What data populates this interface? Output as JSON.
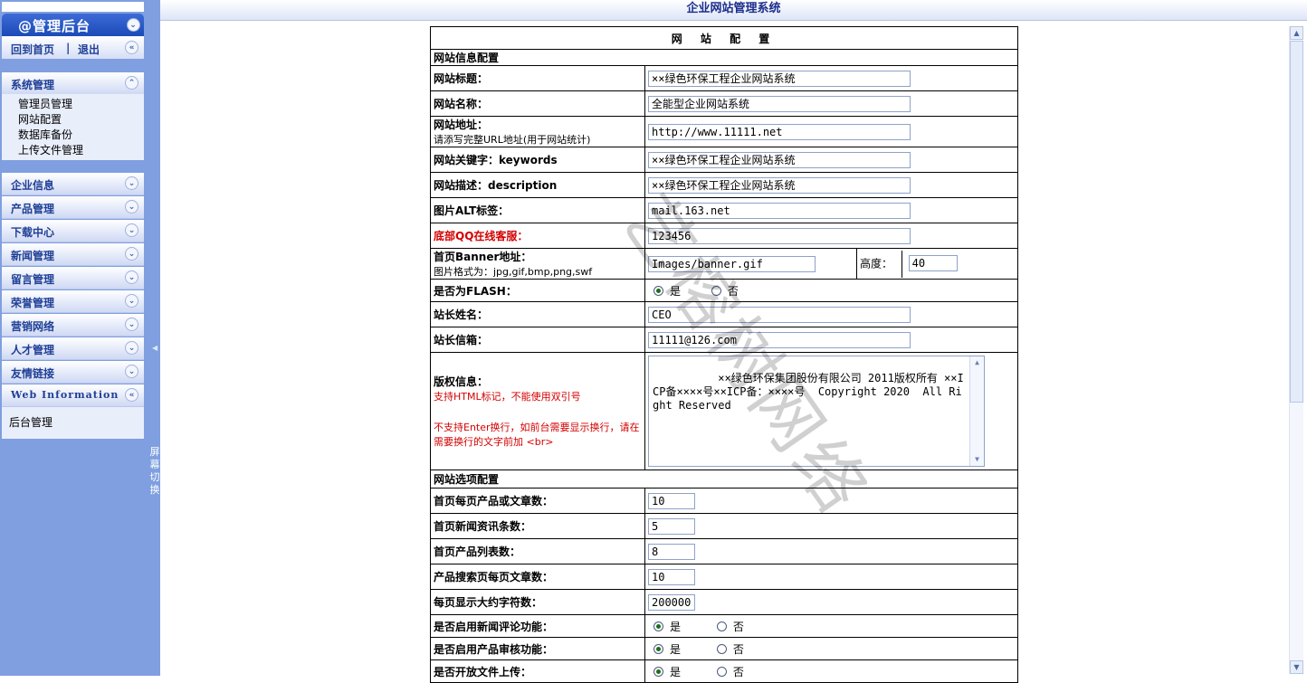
{
  "sidebar": {
    "admin_title": "@管理后台",
    "links": {
      "home": "回到首页",
      "sep": "|",
      "logout": "退出"
    },
    "system": {
      "title": "系统管理",
      "items": [
        "管理员管理",
        "网站配置",
        "数据库备份",
        "上传文件管理"
      ]
    },
    "menus": [
      "企业信息",
      "产品管理",
      "下载中心",
      "新闻管理",
      "留言管理",
      "荣誉管理",
      "营销网络",
      "人才管理",
      "友情链接"
    ],
    "web_info": {
      "title": "Web Information",
      "item": "后台管理"
    }
  },
  "splitter": {
    "label": "屏幕切换"
  },
  "header": {
    "title": "企业网站管理系统"
  },
  "form": {
    "heading": "网 站 配 置",
    "section_info": "网站信息配置",
    "site_title": {
      "label": "网站标题：",
      "value": "××绿色环保工程企业网站系统"
    },
    "site_name": {
      "label": "网站名称：",
      "value": "全能型企业网站系统"
    },
    "site_url": {
      "label": "网站地址：",
      "hint": "请添写完整URL地址(用于网站统计)",
      "value": "http://www.11111.net"
    },
    "keywords": {
      "label": "网站关键字：keywords",
      "value": "××绿色环保工程企业网站系统"
    },
    "description": {
      "label": "网站描述：description",
      "value": "××绿色环保工程企业网站系统"
    },
    "img_alt": {
      "label": "图片ALT标签：",
      "value": "mail.163.net"
    },
    "qq": {
      "label": "底部QQ在线客服：",
      "value": "123456"
    },
    "banner": {
      "label": "首页Banner地址：",
      "hint": "图片格式为：jpg,gif,bmp,png,swf",
      "value": "Images/banner.gif",
      "height_label": "高度：",
      "height_value": "40"
    },
    "flash": {
      "label": "是否为FLASH：",
      "yes": "是",
      "no": "否"
    },
    "owner_name": {
      "label": "站长姓名：",
      "value": "CEO"
    },
    "owner_email": {
      "label": "站长信箱：",
      "value": "11111@126.com"
    },
    "copyright": {
      "label": "版权信息：",
      "hint1": "支持HTML标记，不能使用双引号",
      "hint2": "不支持Enter换行，如前台需要显示换行，请在需要换行的文字前加 <br>",
      "value": "××绿色环保集团股份有限公司 2011版权所有 ××ICP备××××号××ICP备：××××号  Copyright 2020  All Right Reserved"
    },
    "section_options": "网站选项配置",
    "per_page": {
      "label": "首页每页产品或文章数：",
      "value": "10"
    },
    "news_count": {
      "label": "首页新闻资讯条数：",
      "value": "5"
    },
    "product_list": {
      "label": "首页产品列表数：",
      "value": "8"
    },
    "search_per_page": {
      "label": "产品搜索页每页文章数：",
      "value": "10"
    },
    "max_chars": {
      "label": "每页显示大约字符数：",
      "value": "200000"
    },
    "news_comment": {
      "label": "是否启用新闻评论功能：",
      "yes": "是",
      "no": "否"
    },
    "product_audit": {
      "label": "是否启用产品审核功能：",
      "yes": "是",
      "no": "否"
    },
    "file_upload": {
      "label": "是否开放文件上传：",
      "yes": "是",
      "no": "否"
    }
  },
  "watermark": "艺榕树网络",
  "colors": {
    "sidebar": "#7f9fe0",
    "accent": "#1b4bb8",
    "title": "#1b2e8c",
    "warning": "#d40000"
  }
}
